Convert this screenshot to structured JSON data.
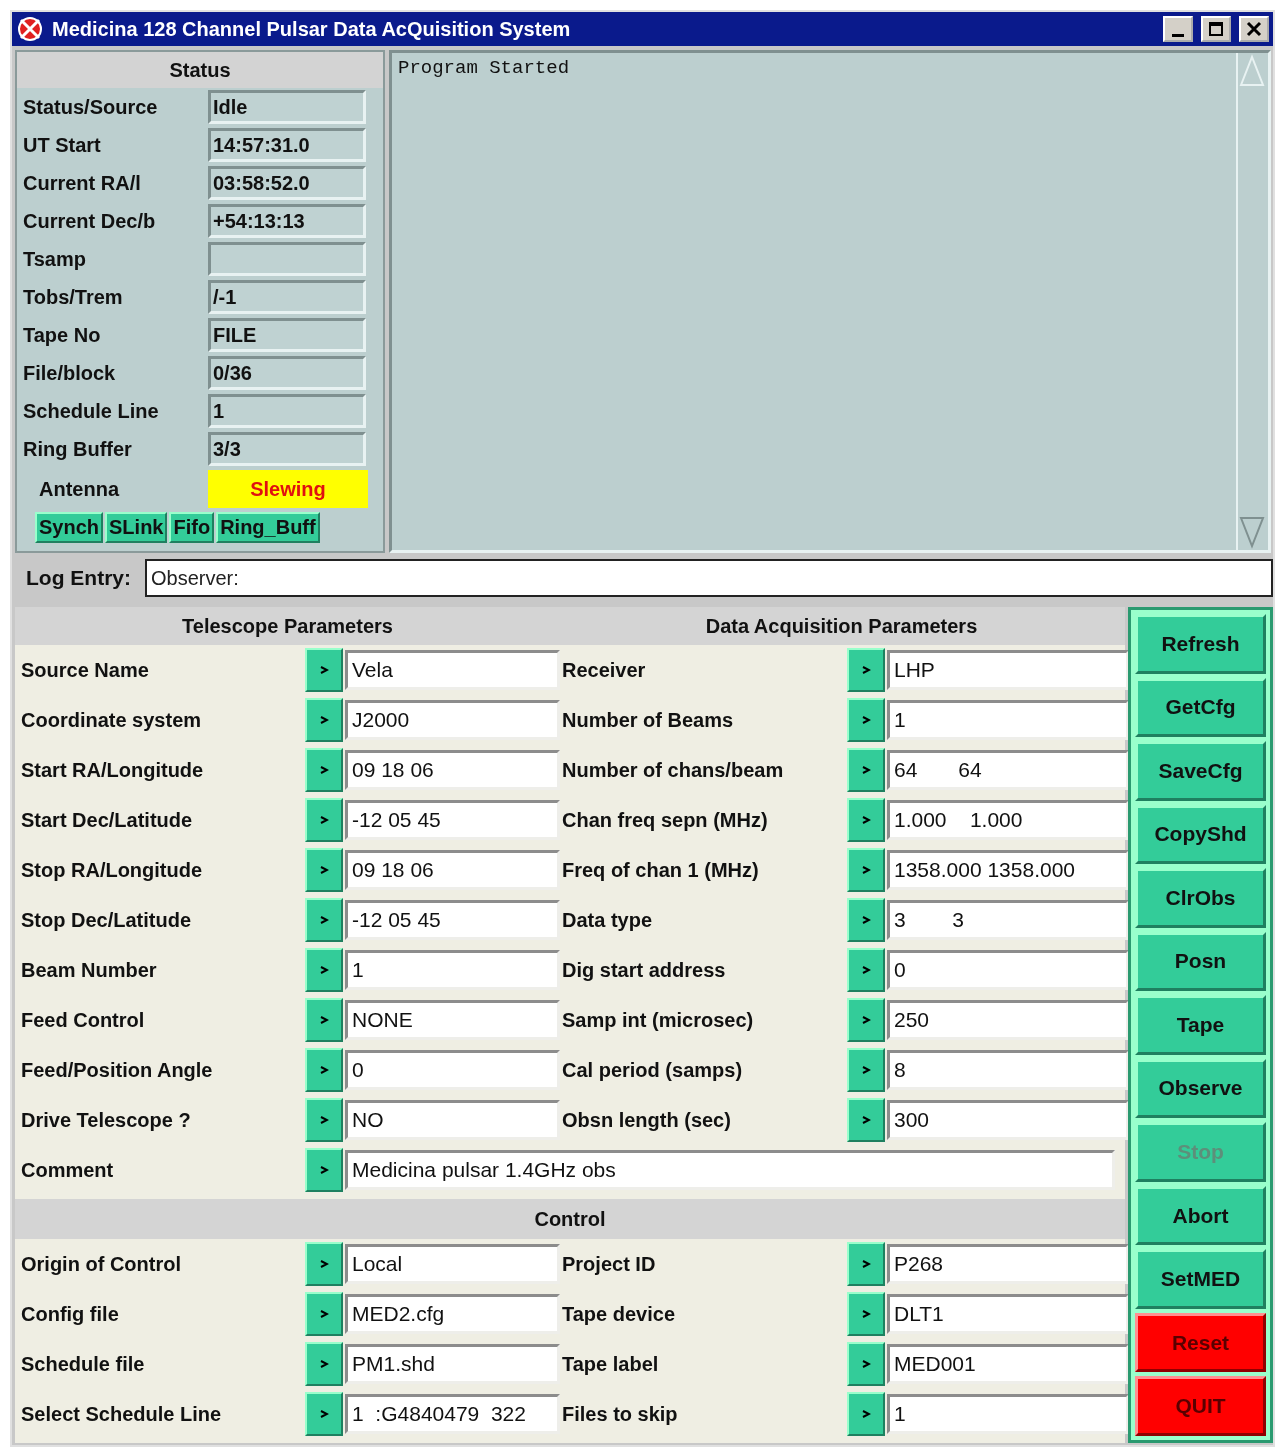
{
  "window": {
    "title": "Medicina 128 Channel Pulsar Data AcQuisition System"
  },
  "status": {
    "title": "Status",
    "rows": [
      {
        "label": "Status/Source",
        "value": "Idle"
      },
      {
        "label": "UT Start",
        "value": "14:57:31.0"
      },
      {
        "label": "Current RA/l",
        "value": "03:58:52.0"
      },
      {
        "label": "Current Dec/b",
        "value": "+54:13:13"
      },
      {
        "label": "Tsamp",
        "value": ""
      },
      {
        "label": "Tobs/Trem",
        "value": "/-1"
      },
      {
        "label": "Tape No",
        "value": "FILE"
      },
      {
        "label": "File/block",
        "value": "0/36"
      },
      {
        "label": "Schedule Line",
        "value": "1"
      },
      {
        "label": "Ring Buffer",
        "value": "3/3"
      }
    ],
    "antenna": {
      "label": "Antenna",
      "value": "Slewing"
    },
    "indicators": [
      "Synch",
      "SLink",
      "Fifo",
      "Ring_Buff"
    ]
  },
  "log_output": {
    "lines": [
      "Program Started"
    ]
  },
  "log_entry": {
    "label": "Log Entry:",
    "value": "Observer:"
  },
  "telescope": {
    "title": "Telescope Parameters",
    "fields": [
      {
        "label": "Source Name",
        "value": "Vela"
      },
      {
        "label": "Coordinate system",
        "value": "J2000"
      },
      {
        "label": "Start RA/Longitude",
        "value": "09 18 06"
      },
      {
        "label": "Start Dec/Latitude",
        "value": "-12 05 45"
      },
      {
        "label": "Stop RA/Longitude",
        "value": "09 18 06"
      },
      {
        "label": "Stop Dec/Latitude",
        "value": "-12 05 45"
      },
      {
        "label": "Beam Number",
        "value": "1"
      },
      {
        "label": "Feed Control",
        "value": "NONE"
      },
      {
        "label": "Feed/Position Angle",
        "value": "0"
      },
      {
        "label": "Drive Telescope ?",
        "value": "NO"
      }
    ]
  },
  "acquisition": {
    "title": "Data Acquisition Parameters",
    "fields": [
      {
        "label": "Receiver",
        "value": "LHP"
      },
      {
        "label": "Number of Beams",
        "value": "1"
      },
      {
        "label": "Number of chans/beam",
        "value": "64       64"
      },
      {
        "label": "Chan freq sepn (MHz)",
        "value": "1.000    1.000"
      },
      {
        "label": "Freq of chan 1 (MHz)",
        "value": "1358.000 1358.000"
      },
      {
        "label": "Data type",
        "value": "3        3"
      },
      {
        "label": "Dig start address",
        "value": "0"
      },
      {
        "label": "Samp int (microsec)",
        "value": "250"
      },
      {
        "label": "Cal period (samps)",
        "value": "8"
      },
      {
        "label": "Obsn length (sec)",
        "value": "300"
      }
    ]
  },
  "comment": {
    "label": "Comment",
    "value": "Medicina pulsar 1.4GHz obs"
  },
  "control": {
    "title": "Control",
    "left": [
      {
        "label": "Origin of Control",
        "value": "Local"
      },
      {
        "label": "Config file",
        "value": "MED2.cfg"
      },
      {
        "label": "Schedule file",
        "value": "PM1.shd"
      },
      {
        "label": "Select Schedule Line",
        "value": "1  :G4840479  322"
      }
    ],
    "right": [
      {
        "label": "Project ID",
        "value": "P268"
      },
      {
        "label": "Tape device",
        "value": "DLT1"
      },
      {
        "label": "Tape label",
        "value": "MED001"
      },
      {
        "label": "Files to skip",
        "value": "1"
      }
    ]
  },
  "buttons": [
    {
      "label": "Refresh",
      "kind": "normal",
      "disabled": false
    },
    {
      "label": "GetCfg",
      "kind": "normal",
      "disabled": false
    },
    {
      "label": "SaveCfg",
      "kind": "normal",
      "disabled": false
    },
    {
      "label": "CopyShd",
      "kind": "normal",
      "disabled": false
    },
    {
      "label": "ClrObs",
      "kind": "normal",
      "disabled": false
    },
    {
      "label": "Posn",
      "kind": "normal",
      "disabled": false
    },
    {
      "label": "Tape",
      "kind": "normal",
      "disabled": false
    },
    {
      "label": "Observe",
      "kind": "normal",
      "disabled": false
    },
    {
      "label": "Stop",
      "kind": "normal",
      "disabled": true
    },
    {
      "label": "Abort",
      "kind": "normal",
      "disabled": false
    },
    {
      "label": "SetMED",
      "kind": "normal",
      "disabled": false
    },
    {
      "label": "Reset",
      "kind": "danger",
      "disabled": false
    },
    {
      "label": "QUIT",
      "kind": "danger",
      "disabled": false
    }
  ]
}
